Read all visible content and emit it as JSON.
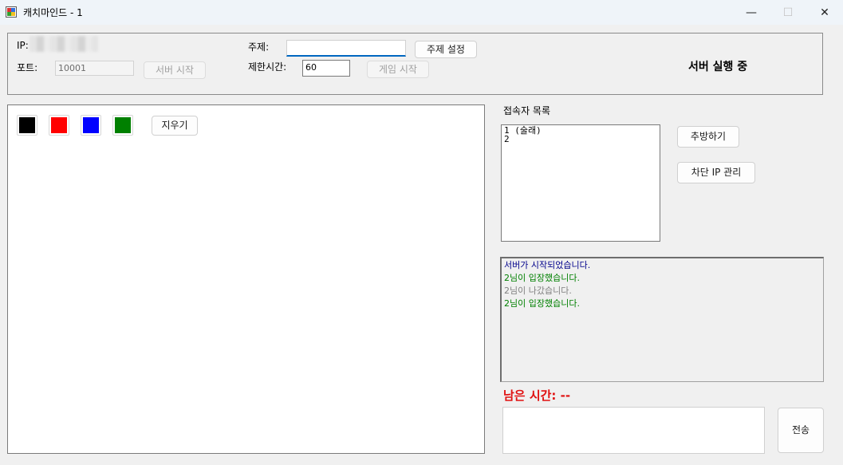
{
  "window": {
    "title": "캐치마인드 - 1",
    "minimize_glyph": "—",
    "maximize_glyph": "☐",
    "close_glyph": "✕"
  },
  "server": {
    "ip_label": "IP:",
    "port_label": "포트:",
    "port_value": "10001",
    "start_server_label": "서버 시작",
    "topic_label": "주제:",
    "topic_value": "",
    "set_topic_label": "주제 설정",
    "time_limit_label": "제한시간:",
    "time_limit_value": "60",
    "start_game_label": "게임 시작",
    "status": "서버 실행 중"
  },
  "drawing": {
    "colors": [
      "#000000",
      "#ff0000",
      "#0000ff",
      "#008000"
    ],
    "clear_label": "지우기"
  },
  "users": {
    "title": "접속자 목록",
    "items": [
      "1 (술래)",
      "2"
    ],
    "kick_label": "추방하기",
    "ban_label": "차단 IP 관리"
  },
  "log": {
    "lines": [
      {
        "text": "서버가 시작되었습니다.",
        "color": "#00008b"
      },
      {
        "text": "2님이 입장했습니다.",
        "color": "#008000"
      },
      {
        "text": "2님이 나갔습니다.",
        "color": "#808080"
      },
      {
        "text": "2님이 입장했습니다.",
        "color": "#008000"
      }
    ]
  },
  "timer": {
    "text": "남은 시간: --"
  },
  "chat": {
    "message": "",
    "send_label": "전송"
  }
}
